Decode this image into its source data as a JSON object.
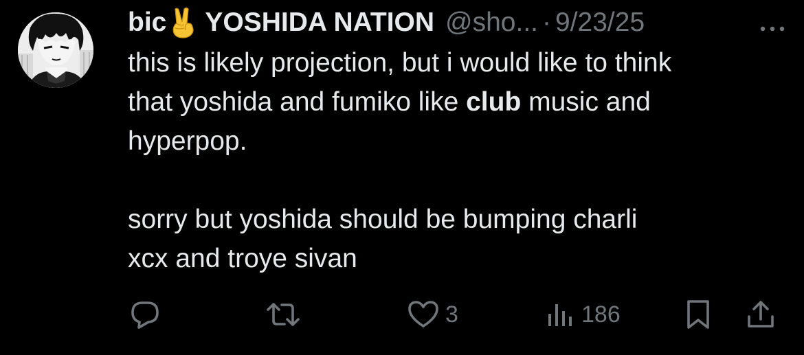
{
  "tweet": {
    "author": {
      "name_prefix": "bic",
      "emoji_icon": "victory-hand-icon",
      "display_name": "YOSHIDA NATION",
      "handle": "@sho...",
      "separator": "·",
      "date": "9/23/25"
    },
    "body": {
      "line1": "this is likely projection, but i would like to think",
      "line2_before": "that yoshida and fumiko like ",
      "line2_bold": "club",
      "line2_after": " music and",
      "line3": "hyperpop.",
      "line4": "sorry but yoshida should be bumping charli",
      "line5": "xcx and troye sivan"
    },
    "actions": {
      "reply_count": "",
      "retweet_count": "",
      "like_count": "3",
      "views_count": "186"
    }
  },
  "colors": {
    "background": "#000000",
    "text": "#e7e9ea",
    "secondary": "#71767b",
    "emoji": "#f7c434"
  }
}
